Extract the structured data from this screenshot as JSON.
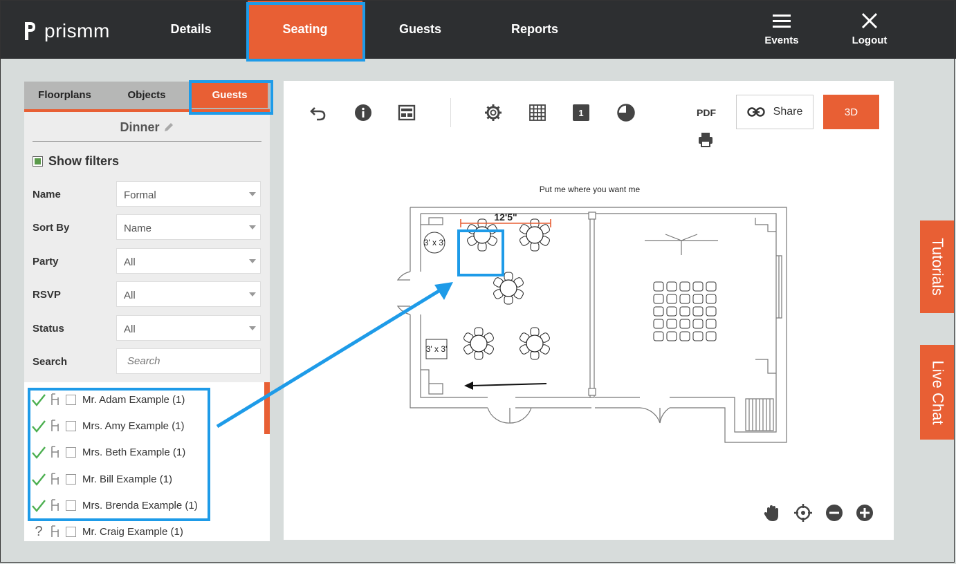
{
  "app": {
    "logo_text": "prismm",
    "nav": [
      {
        "label": "Details"
      },
      {
        "label": "Seating"
      },
      {
        "label": "Guests"
      },
      {
        "label": "Reports"
      }
    ],
    "events_label": "Events",
    "logout_label": "Logout"
  },
  "sidebar": {
    "tabs": [
      {
        "label": "Floorplans"
      },
      {
        "label": "Objects"
      },
      {
        "label": "Guests"
      }
    ],
    "event_name": "Dinner",
    "show_filters_label": "Show filters",
    "filters": [
      {
        "label": "Name",
        "value": "Formal"
      },
      {
        "label": "Sort By",
        "value": "Name"
      },
      {
        "label": "Party",
        "value": "All"
      },
      {
        "label": "RSVP",
        "value": "All"
      },
      {
        "label": "Status",
        "value": "All"
      }
    ],
    "search": {
      "label": "Search",
      "placeholder": "Search"
    },
    "guests": [
      {
        "name": "Mr. Adam Example (1)",
        "status": "confirmed"
      },
      {
        "name": "Mrs. Amy Example (1)",
        "status": "confirmed"
      },
      {
        "name": "Mrs. Beth Example (1)",
        "status": "confirmed"
      },
      {
        "name": "Mr. Bill Example (1)",
        "status": "confirmed"
      },
      {
        "name": "Mrs. Brenda Example (1)",
        "status": "confirmed"
      },
      {
        "name": "Mr. Craig Example (1)",
        "status": "unknown"
      }
    ]
  },
  "toolbar": {
    "pdf_label": "PDF",
    "layer_number": "1",
    "share_label": "Share",
    "btn_3d_label": "3D",
    "icons": [
      "undo-icon",
      "info-icon",
      "layout-icon",
      "settings-icon",
      "grid-icon",
      "layer-icon",
      "pie-icon",
      "print-icon",
      "link-icon"
    ]
  },
  "floorplan": {
    "caption": "Put me where you want me",
    "dimension_label": "12'5\"",
    "object_labels": [
      "3' x 3'",
      "3' x 3'"
    ]
  },
  "side_tabs": {
    "tutorials": "Tutorials",
    "live_chat": "Live Chat"
  },
  "colors": {
    "accent": "#e85f34",
    "highlight": "#1e9be8",
    "nav_bg": "#2d2f31",
    "check_green": "#4caf50"
  }
}
